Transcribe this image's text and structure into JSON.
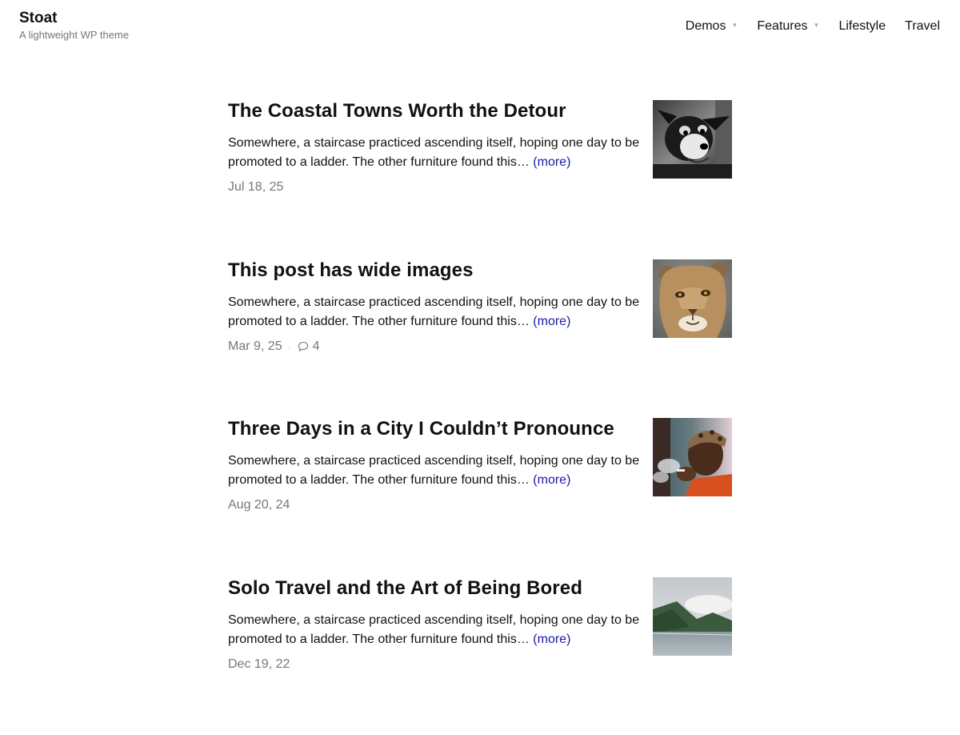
{
  "site": {
    "title": "Stoat",
    "tagline": "A lightweight WP theme"
  },
  "nav": {
    "items": [
      {
        "label": "Demos",
        "has_dropdown": true
      },
      {
        "label": "Features",
        "has_dropdown": true
      },
      {
        "label": "Lifestyle",
        "has_dropdown": false
      },
      {
        "label": "Travel",
        "has_dropdown": false
      }
    ],
    "dropdown_icon": "caret-down-icon"
  },
  "posts": [
    {
      "title": "The Coastal Towns Worth the Detour",
      "excerpt": "Somewhere, a staircase practiced ascending itself, hoping one day to be promoted to a ladder. The other furniture found this…",
      "more_label": "(more)",
      "date": "Jul 18, 25",
      "comments": null,
      "thumbnail": "dog-photo"
    },
    {
      "title": "This post has wide images",
      "excerpt": "Somewhere, a staircase practiced ascending itself, hoping one day to be promoted to a ladder. The other furniture found this…",
      "more_label": "(more)",
      "date": "Mar 9, 25",
      "comments": "4",
      "thumbnail": "lioness-photo"
    },
    {
      "title": "Three Days in a City I Couldn’t Pronounce",
      "excerpt": "Somewhere, a staircase practiced ascending itself, hoping one day to be promoted to a ladder. The other furniture found this…",
      "more_label": "(more)",
      "date": "Aug 20, 24",
      "comments": null,
      "thumbnail": "smoking-man-photo"
    },
    {
      "title": "Solo Travel and the Art of Being Bored",
      "excerpt": "Somewhere, a staircase practiced ascending itself, hoping one day to be promoted to a ladder. The other furniture found this…",
      "more_label": "(more)",
      "date": "Dec 19, 22",
      "comments": null,
      "thumbnail": "fjord-landscape-photo"
    }
  ],
  "colors": {
    "text": "#111111",
    "muted": "#777777",
    "link": "#1a1aa6",
    "background": "#ffffff"
  },
  "icons": {
    "comment": "comment-bubble-icon",
    "meta_separator": "·"
  }
}
